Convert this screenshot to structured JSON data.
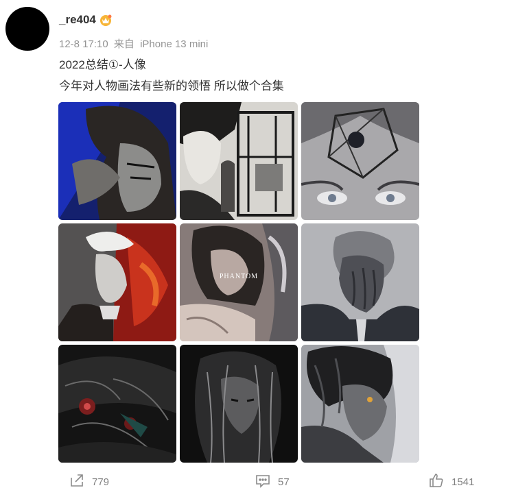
{
  "author": {
    "name": "_re404",
    "badge_icon": "vip-crown-icon",
    "avatar_color": "#000000"
  },
  "meta": {
    "time": "12-8 17:10",
    "from": "来自",
    "device": "iPhone 13 mini"
  },
  "content": {
    "line1": "2022总结①-人像",
    "line2": "今年对人物画法有些新的领悟 所以做个合集"
  },
  "images": [
    {
      "name": "portrait-blue-hand"
    },
    {
      "name": "portrait-man-with-window"
    },
    {
      "name": "portrait-cube-eyes"
    },
    {
      "name": "portrait-white-hair-red"
    },
    {
      "name": "portrait-phantom",
      "text": "PHANTOM"
    },
    {
      "name": "portrait-face-in-hands"
    },
    {
      "name": "portrait-dark-red-eyes"
    },
    {
      "name": "portrait-dark-long-hair"
    },
    {
      "name": "portrait-side-profile"
    }
  ],
  "actions": {
    "share_count": "779",
    "comment_count": "57",
    "like_count": "1541"
  },
  "colors": {
    "meta_text": "#939393",
    "action_text": "#808080",
    "badge": "#f5a623"
  }
}
